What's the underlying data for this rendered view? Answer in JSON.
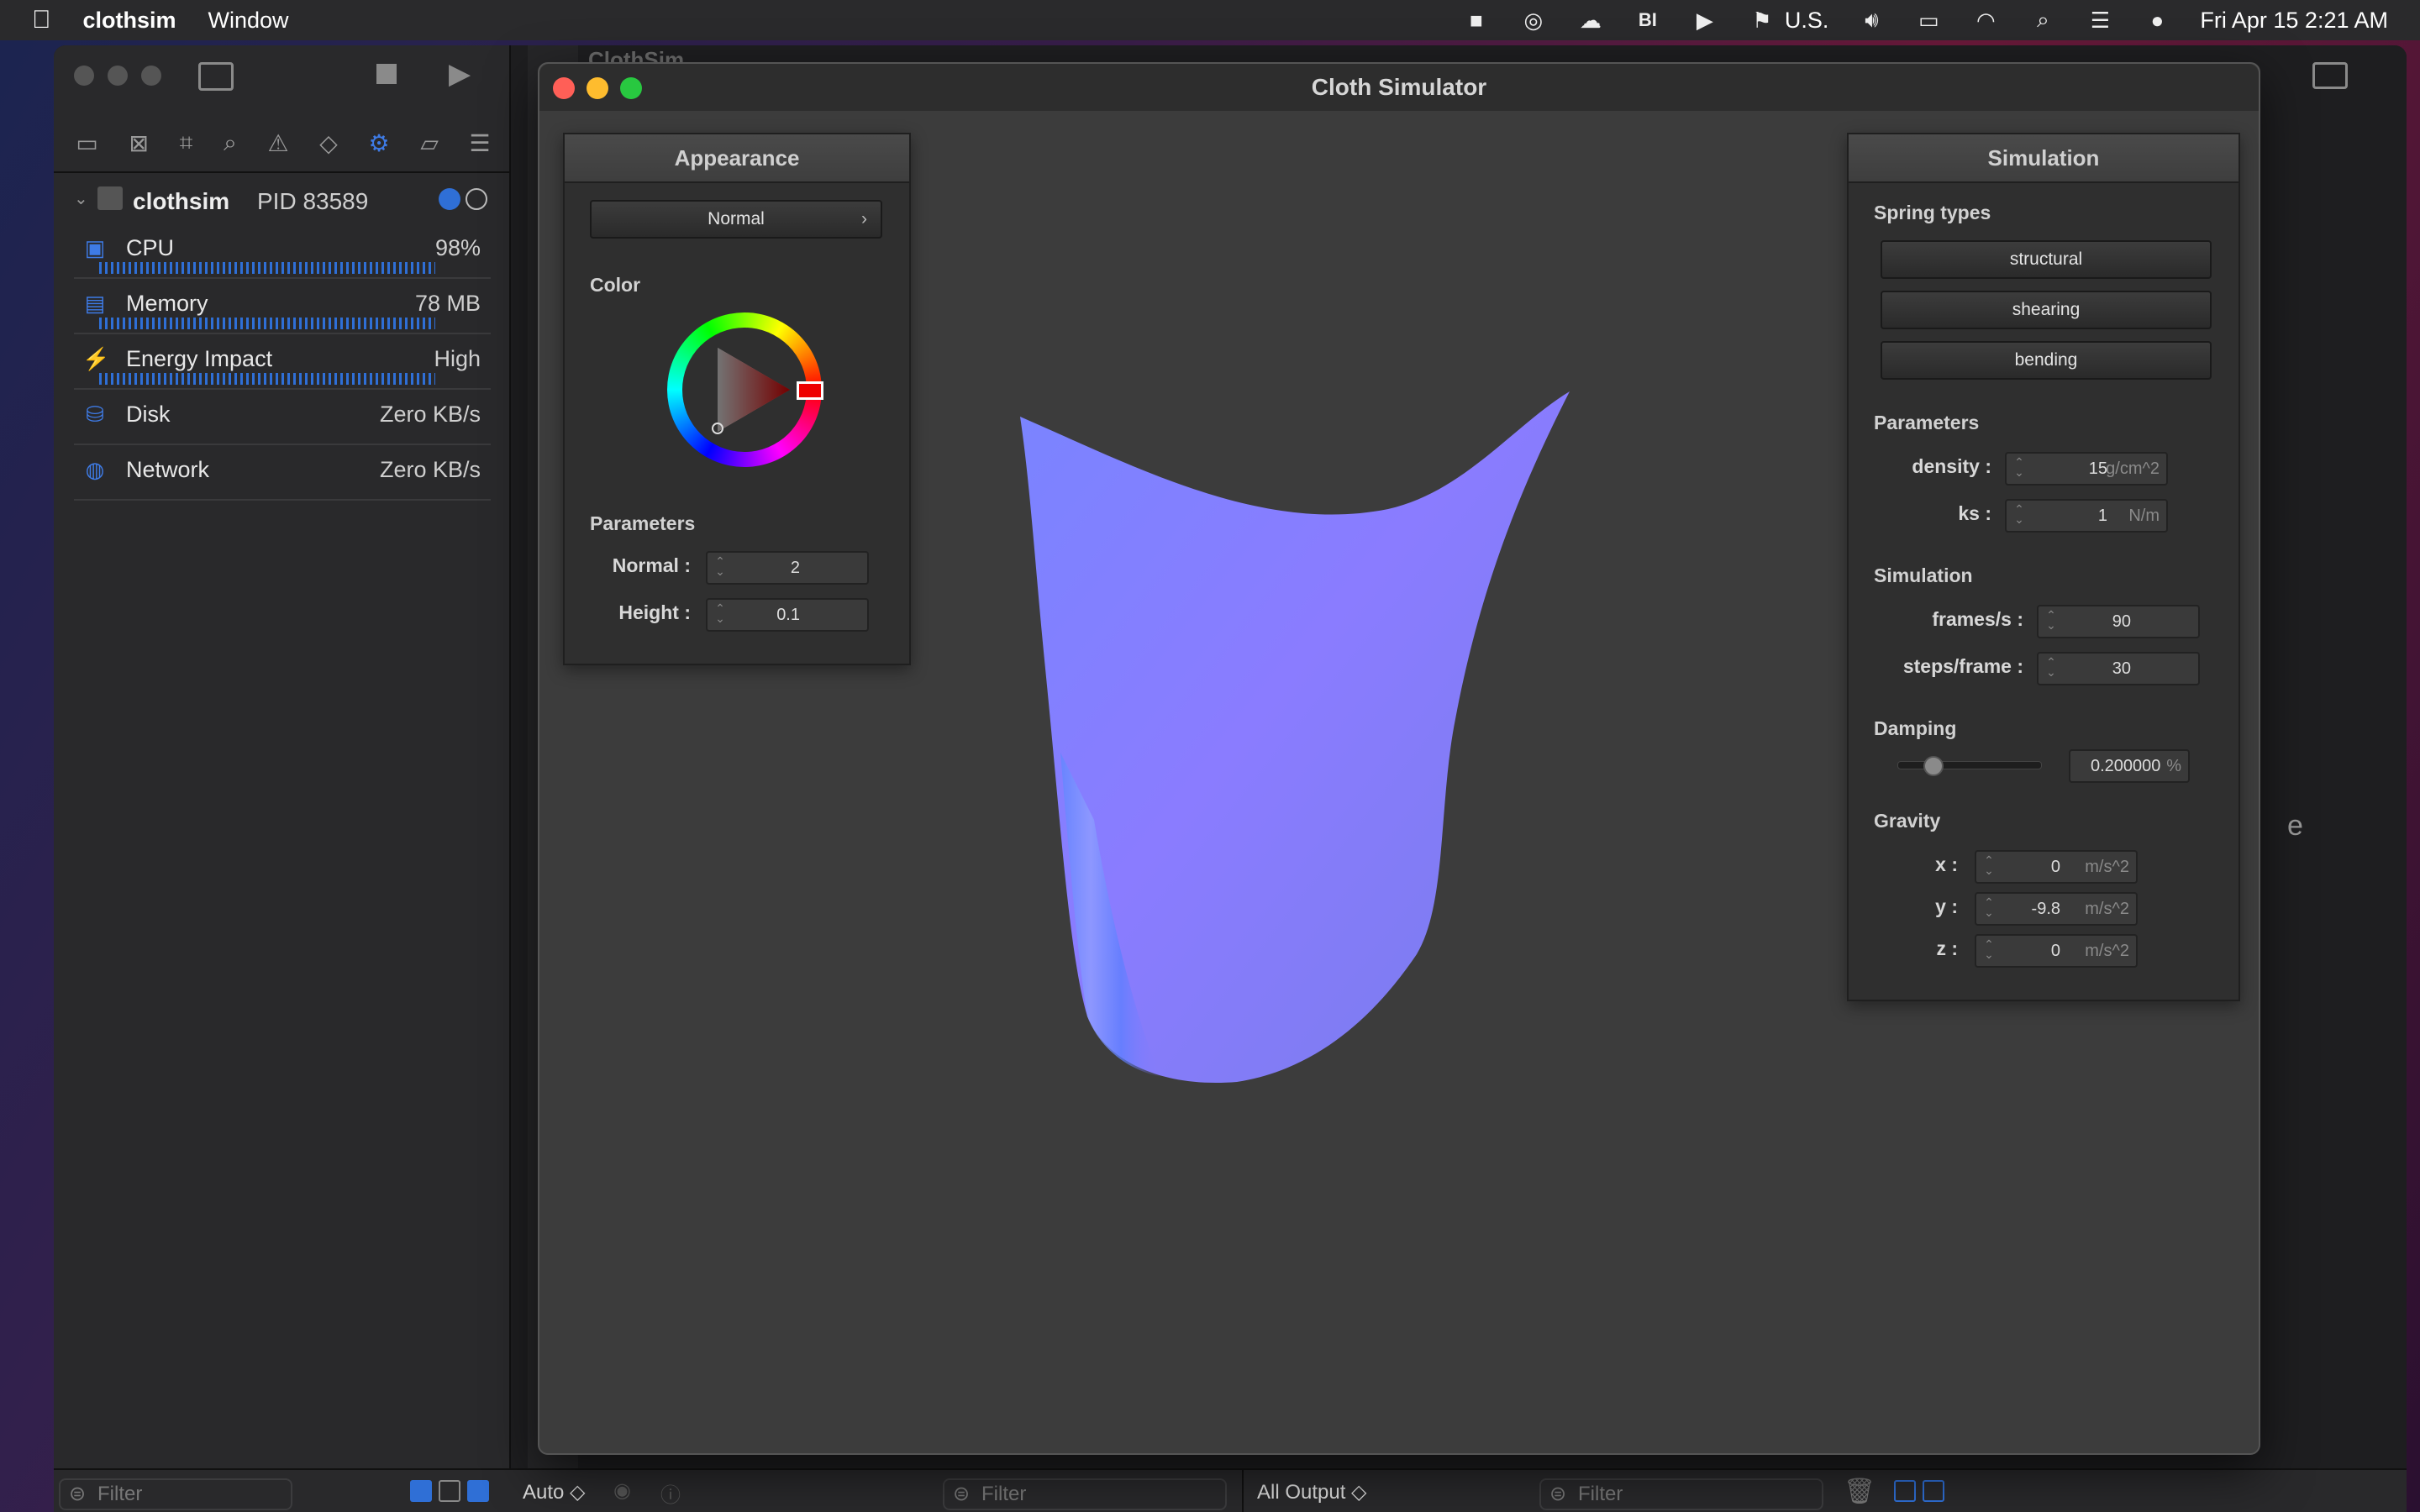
{
  "menubar": {
    "app_name": "clothsim",
    "menu_window": "Window",
    "input_source": "U.S.",
    "clock": "Fri Apr 15  2:21 AM"
  },
  "debug_navigator": {
    "process_name": "clothsim",
    "pid": "PID 83589",
    "rows": [
      {
        "label": "CPU",
        "value": "98%",
        "icon": "cpu-icon"
      },
      {
        "label": "Memory",
        "value": "78 MB",
        "icon": "memory-icon"
      },
      {
        "label": "Energy Impact",
        "value": "High",
        "icon": "energy-icon"
      },
      {
        "label": "Disk",
        "value": "Zero KB/s",
        "icon": "disk-icon"
      },
      {
        "label": "Network",
        "value": "Zero KB/s",
        "icon": "network-icon"
      }
    ],
    "filter_placeholder": "Filter"
  },
  "editor": {
    "tab_title": "ClothSim",
    "bottom_auto": "Auto ◇",
    "bottom_filter": "Filter",
    "bottom_output": "All Output ◇",
    "bottom_filter2": "Filter",
    "stray_letter": "e"
  },
  "sim_window": {
    "title": "Cloth Simulator",
    "appearance": {
      "header": "Appearance",
      "shader_select": "Normal",
      "color_label": "Color",
      "params_label": "Parameters",
      "normal_label": "Normal :",
      "normal_value": "2",
      "height_label": "Height :",
      "height_value": "0.1"
    },
    "simulation": {
      "header": "Simulation",
      "spring_types_label": "Spring types",
      "spring_buttons": [
        "structural",
        "shearing",
        "bending"
      ],
      "params_label": "Parameters",
      "density_label": "density :",
      "density_value": "15",
      "density_unit": "g/cm^2",
      "ks_label": "ks :",
      "ks_value": "1",
      "ks_unit": "N/m",
      "simulation_label": "Simulation",
      "fps_label": "frames/s :",
      "fps_value": "90",
      "steps_label": "steps/frame :",
      "steps_value": "30",
      "damping_label": "Damping",
      "damping_value": "0.200000",
      "damping_unit": "%",
      "damping_fraction": 0.2,
      "gravity_label": "Gravity",
      "gx_label": "x :",
      "gx_value": "0",
      "gy_label": "y :",
      "gy_value": "-9.8",
      "gz_label": "z :",
      "gz_value": "0",
      "g_unit": "m/s^2"
    }
  }
}
